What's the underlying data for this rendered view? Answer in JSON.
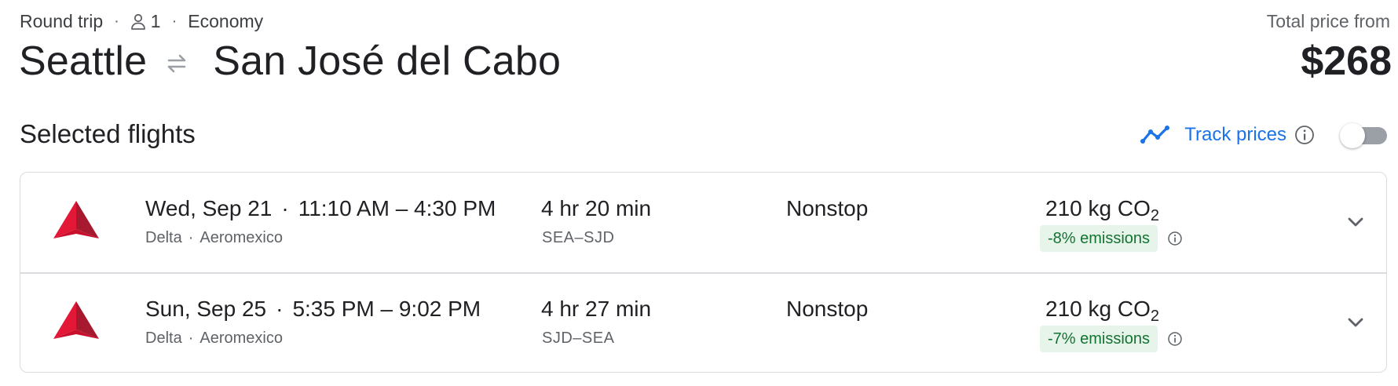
{
  "header": {
    "trip_type": "Round trip",
    "passengers": "1",
    "cabin": "Economy",
    "origin": "Seattle",
    "destination": "San José del Cabo",
    "price_label": "Total price from",
    "price": "$268",
    "separator": "·",
    "icons": {
      "passenger": "person-icon",
      "swap": "swap-arrows-icon"
    }
  },
  "section": {
    "title": "Selected flights",
    "track_label": "Track prices",
    "track_enabled": false,
    "icons": {
      "trend": "trend-line-icon",
      "info": "info-icon"
    }
  },
  "flights": [
    {
      "date": "Wed, Sep 21",
      "time_range": "11:10 AM – 4:30 PM",
      "airline": "Delta",
      "operator": "Aeromexico",
      "duration": "4 hr 20 min",
      "airports": "SEA–SJD",
      "stops": "Nonstop",
      "co2_value": "210 kg CO",
      "co2_sub": "2",
      "emissions": "-8% emissions",
      "logo": "delta-logo-icon"
    },
    {
      "date": "Sun, Sep 25",
      "time_range": "5:35 PM – 9:02 PM",
      "airline": "Delta",
      "operator": "Aeromexico",
      "duration": "4 hr 27 min",
      "airports": "SJD–SEA",
      "stops": "Nonstop",
      "co2_value": "210 kg CO",
      "co2_sub": "2",
      "emissions": "-7% emissions",
      "logo": "delta-logo-icon"
    }
  ],
  "colors": {
    "accent_blue": "#1a73e8",
    "emissions_bg": "#e6f4ea",
    "emissions_text": "#137333",
    "delta_red_light": "#e31837",
    "delta_red_dark": "#a6192e",
    "border": "#dadce0"
  }
}
